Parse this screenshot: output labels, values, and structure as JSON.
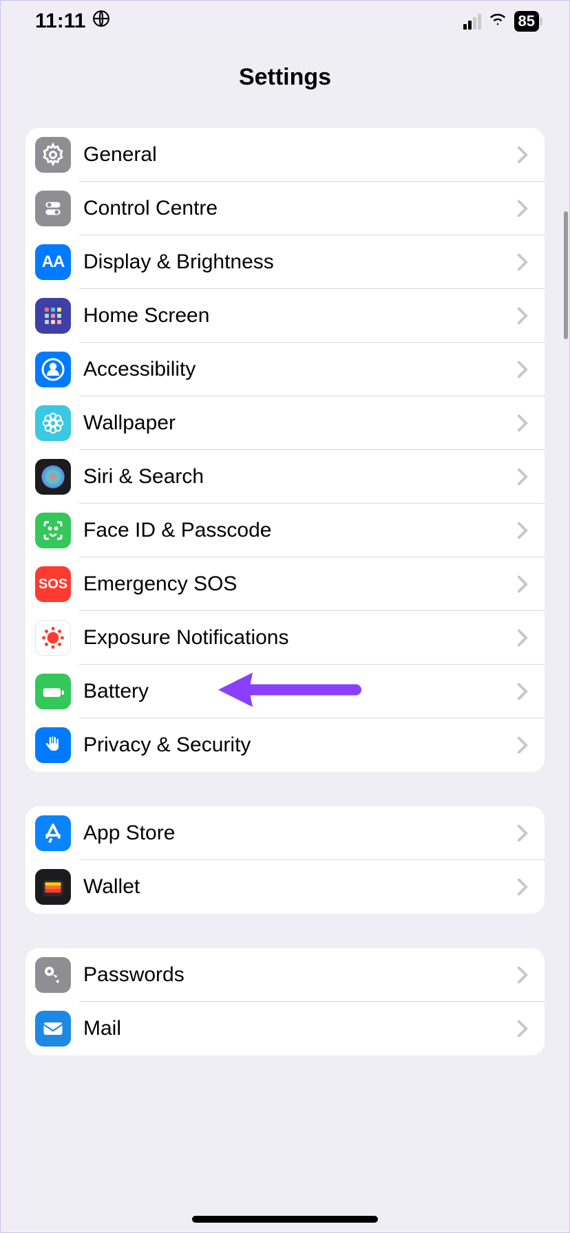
{
  "status": {
    "time": "11:11",
    "battery": "85"
  },
  "title": "Settings",
  "groups": [
    {
      "items": [
        {
          "id": "general",
          "label": "General",
          "icon": "gear",
          "bg": "#8e8e93"
        },
        {
          "id": "control-centre",
          "label": "Control Centre",
          "icon": "toggles",
          "bg": "#8e8e93"
        },
        {
          "id": "display",
          "label": "Display & Brightness",
          "icon": "aa",
          "bg": "#007aff"
        },
        {
          "id": "home-screen",
          "label": "Home Screen",
          "icon": "grid",
          "bg": "#3f3fa8"
        },
        {
          "id": "accessibility",
          "label": "Accessibility",
          "icon": "person",
          "bg": "#007aff"
        },
        {
          "id": "wallpaper",
          "label": "Wallpaper",
          "icon": "flower",
          "bg": "#3ac8e3"
        },
        {
          "id": "siri",
          "label": "Siri & Search",
          "icon": "siri",
          "bg": "#1c1c1e"
        },
        {
          "id": "faceid",
          "label": "Face ID & Passcode",
          "icon": "face",
          "bg": "#34c759"
        },
        {
          "id": "sos",
          "label": "Emergency SOS",
          "icon": "sos",
          "bg": "#ff3b30"
        },
        {
          "id": "exposure",
          "label": "Exposure Notifications",
          "icon": "dots",
          "bg": "#fff"
        },
        {
          "id": "battery",
          "label": "Battery",
          "icon": "battery",
          "bg": "#34c759",
          "arrow": true
        },
        {
          "id": "privacy",
          "label": "Privacy & Security",
          "icon": "hand",
          "bg": "#007aff"
        }
      ]
    },
    {
      "items": [
        {
          "id": "appstore",
          "label": "App Store",
          "icon": "appstore",
          "bg": "#0a84ff"
        },
        {
          "id": "wallet",
          "label": "Wallet",
          "icon": "wallet",
          "bg": "#1c1c1e"
        }
      ]
    },
    {
      "items": [
        {
          "id": "passwords",
          "label": "Passwords",
          "icon": "key",
          "bg": "#8e8e93"
        },
        {
          "id": "mail",
          "label": "Mail",
          "icon": "mail",
          "bg": "#1e88e5"
        }
      ]
    }
  ]
}
